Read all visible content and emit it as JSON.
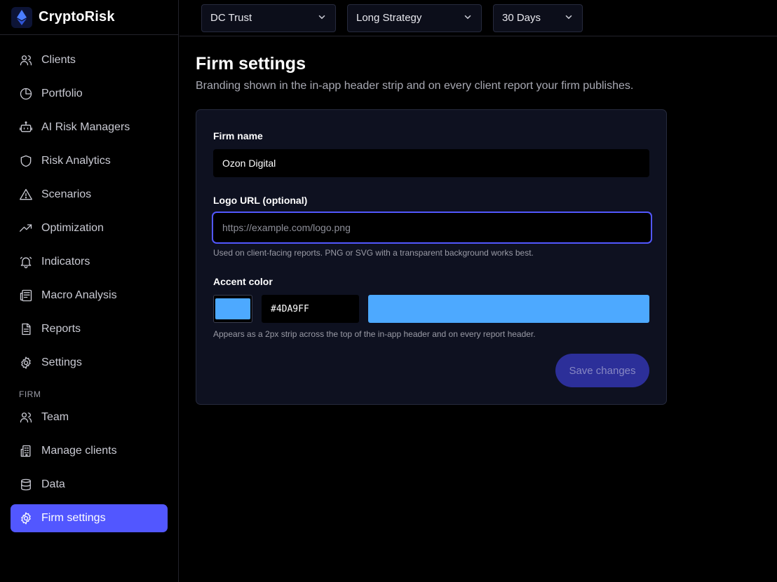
{
  "brand": {
    "name": "CryptoRisk",
    "logo_icon": "ethereum-diamond-icon"
  },
  "nav": {
    "items": [
      {
        "label": "Clients",
        "icon": "users-icon"
      },
      {
        "label": "Portfolio",
        "icon": "pie-chart-icon"
      },
      {
        "label": "AI Risk Managers",
        "icon": "bot-icon"
      },
      {
        "label": "Risk Analytics",
        "icon": "shield-icon"
      },
      {
        "label": "Scenarios",
        "icon": "warning-triangle-icon"
      },
      {
        "label": "Optimization",
        "icon": "trending-up-icon"
      },
      {
        "label": "Indicators",
        "icon": "bell-icon"
      },
      {
        "label": "Macro Analysis",
        "icon": "newspaper-icon"
      },
      {
        "label": "Reports",
        "icon": "file-text-icon"
      },
      {
        "label": "Settings",
        "icon": "gear-icon"
      }
    ],
    "section_label": "FIRM",
    "firm_items": [
      {
        "label": "Team",
        "icon": "users-icon"
      },
      {
        "label": "Manage clients",
        "icon": "building-icon"
      },
      {
        "label": "Data",
        "icon": "database-icon"
      },
      {
        "label": "Firm settings",
        "icon": "gear-icon",
        "active": true
      }
    ]
  },
  "topbar": {
    "client_select": "DC Trust",
    "strategy_select": "Long Strategy",
    "period_select": "30 Days"
  },
  "page": {
    "title": "Firm settings",
    "subtitle": "Branding shown in the in-app header strip and on every client report your firm publishes."
  },
  "form": {
    "firm_name_label": "Firm name",
    "firm_name_value": "Ozon Digital",
    "logo_url_label": "Logo URL (optional)",
    "logo_url_placeholder": "https://example.com/logo.png",
    "logo_url_help": "Used on client-facing reports. PNG or SVG with a transparent background works best.",
    "accent_label": "Accent color",
    "accent_hex": "#4DA9FF",
    "accent_help": "Appears as a 2px strip across the top of the in-app header and on every report header.",
    "save_label": "Save changes"
  },
  "colors": {
    "accent": "#4DA9FF",
    "active_nav": "#5257ff",
    "save_button": "#2c2f99"
  }
}
